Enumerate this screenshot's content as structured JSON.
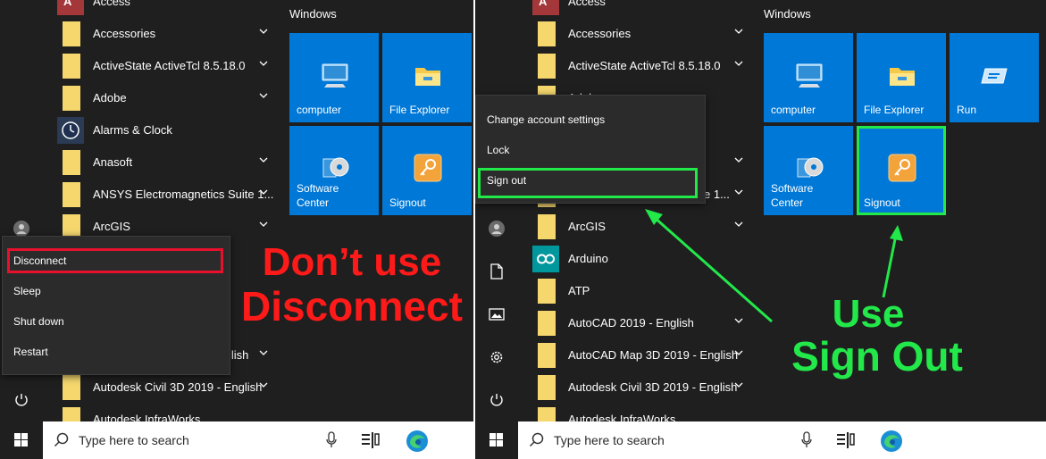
{
  "annotations": {
    "dont_line1": "Don’t use",
    "dont_line2": "Disconnect",
    "use_line1": "Use",
    "use_line2": "Sign Out",
    "red": "#ff1a1a",
    "green": "#22e84a"
  },
  "left": {
    "apps": [
      {
        "label": "Access",
        "icon": "access-icon",
        "chevron": false
      },
      {
        "label": "Accessories",
        "icon": "folder-icon",
        "chevron": true
      },
      {
        "label": "ActiveState ActiveTcl 8.5.18.0",
        "icon": "folder-icon",
        "chevron": true
      },
      {
        "label": "Adobe",
        "icon": "folder-icon",
        "chevron": true
      },
      {
        "label": "Alarms & Clock",
        "icon": "clock-icon",
        "chevron": false
      },
      {
        "label": "Anasoft",
        "icon": "folder-icon",
        "chevron": true
      },
      {
        "label": "ANSYS Electromagnetics Suite 1...",
        "icon": "folder-icon",
        "chevron": true
      },
      {
        "label": "ArcGIS",
        "icon": "folder-icon",
        "chevron": true
      },
      {
        "label": "llish",
        "icon": "folder-icon",
        "chevron": true
      },
      {
        "label": "Autodesk Civil 3D 2019 - English",
        "icon": "folder-icon",
        "chevron": true
      },
      {
        "label": "Autodesk InfraWorks",
        "icon": "folder-icon",
        "chevron": false
      }
    ],
    "tiles_header": "Windows",
    "tiles": [
      {
        "label": "computer",
        "icon": "computer-icon"
      },
      {
        "label": "File Explorer",
        "icon": "file-explorer-icon"
      },
      {
        "label": "Software\nCenter",
        "icon": "software-center-icon"
      },
      {
        "label": "Signout",
        "icon": "key-icon"
      }
    ],
    "power_menu": [
      "Disconnect",
      "Sleep",
      "Shut down",
      "Restart"
    ]
  },
  "right": {
    "apps": [
      {
        "label": "Access",
        "icon": "access-icon",
        "chevron": false
      },
      {
        "label": "Accessories",
        "icon": "folder-icon",
        "chevron": true
      },
      {
        "label": "ActiveState ActiveTcl 8.5.18.0",
        "icon": "folder-icon",
        "chevron": true
      },
      {
        "label": "Adobe",
        "icon": "folder-icon",
        "chevron": true
      },
      {
        "label": "",
        "icon": "folder-icon",
        "chevron": false
      },
      {
        "label": "",
        "icon": "folder-icon",
        "chevron": true
      },
      {
        "label": "e 1...",
        "icon": "folder-icon",
        "chevron": true
      },
      {
        "label": "ArcGIS",
        "icon": "folder-icon",
        "chevron": true
      },
      {
        "label": "Arduino",
        "icon": "arduino-icon",
        "chevron": false
      },
      {
        "label": "ATP",
        "icon": "folder-icon",
        "chevron": false
      },
      {
        "label": "AutoCAD 2019 - English",
        "icon": "folder-icon",
        "chevron": true
      },
      {
        "label": "AutoCAD Map 3D 2019 - English",
        "icon": "folder-icon",
        "chevron": true
      },
      {
        "label": "Autodesk Civil 3D 2019 - English",
        "icon": "folder-icon",
        "chevron": true
      },
      {
        "label": "Autodesk InfraWorks",
        "icon": "folder-icon",
        "chevron": false
      }
    ],
    "tiles_header": "Windows",
    "tiles": [
      {
        "label": "computer",
        "icon": "computer-icon"
      },
      {
        "label": "File Explorer",
        "icon": "file-explorer-icon"
      },
      {
        "label": "Run",
        "icon": "run-icon"
      },
      {
        "label": "Software\nCenter",
        "icon": "software-center-icon"
      },
      {
        "label": "Signout",
        "icon": "key-icon"
      }
    ],
    "account_menu": [
      "Change account settings",
      "Lock",
      "Sign out"
    ]
  },
  "taskbar": {
    "search_placeholder": "Type here to search"
  }
}
